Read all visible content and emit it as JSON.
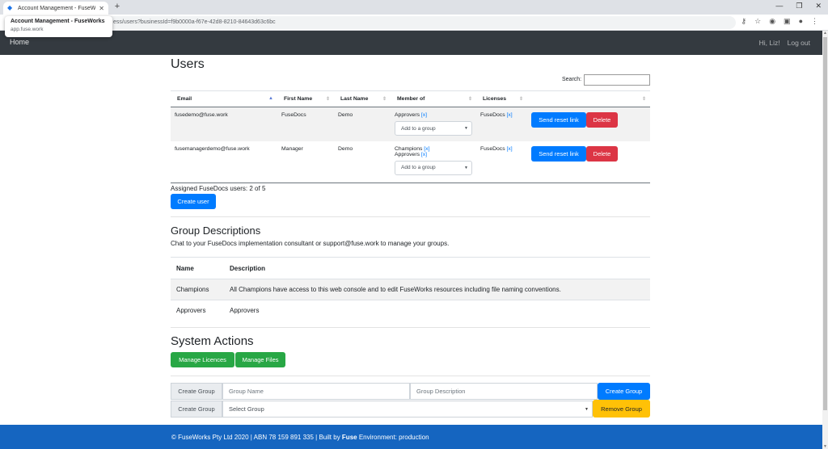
{
  "browser": {
    "tab_title": "Account Management - FuseWo",
    "url": "ess/users?businessId=f9b0000a-f67e-42d8-8210-84643d63c6bc",
    "tooltip_title": "Account Management - FuseWorks",
    "tooltip_url": "app.fuse.work"
  },
  "nav": {
    "home": "Home",
    "greeting": "Hi, Liz!",
    "logout": "Log out"
  },
  "users": {
    "title": "Users",
    "search_label": "Search:",
    "columns": [
      "Email",
      "First Name",
      "Last Name",
      "Member of",
      "Licenses",
      ""
    ],
    "rows": [
      {
        "email": "fusedemo@fuse.work",
        "first": "FuseDocs",
        "last": "Demo",
        "groups": [
          "Approvers"
        ],
        "licenses": [
          "FuseDocs"
        ],
        "select": "Add to a group",
        "reset": "Send reset link",
        "delete": "Delete"
      },
      {
        "email": "fusemanagerdemo@fuse.work",
        "first": "Manager",
        "last": "Demo",
        "groups": [
          "Champions",
          "Approvers"
        ],
        "licenses": [
          "FuseDocs"
        ],
        "select": "Add to a group",
        "reset": "Send reset link",
        "delete": "Delete"
      }
    ],
    "remove_marker": "[x]",
    "assigned": "Assigned FuseDocs users: 2 of 5",
    "create_user": "Create user"
  },
  "groups": {
    "title": "Group Descriptions",
    "subtitle": "Chat to your FuseDocs implementation consultant or support@fuse.work to manage your groups.",
    "col_name": "Name",
    "col_desc": "Description",
    "rows": [
      {
        "name": "Champions",
        "desc": "All Champions have access to this web console and to edit FuseWorks resources including file naming conventions."
      },
      {
        "name": "Approvers",
        "desc": "Approvers"
      }
    ]
  },
  "system": {
    "title": "System Actions",
    "manage_licences": "Manage Licences",
    "manage_files": "Manage Files",
    "create_group_addon": "Create Group",
    "group_name_placeholder": "Group Name",
    "group_desc_placeholder": "Group Description",
    "create_group_btn": "Create Group",
    "remove_group_addon": "Create Group",
    "select_group": "Select Group",
    "remove_group_btn": "Remove Group"
  },
  "footer": {
    "prefix": "© FuseWorks Pty Ltd 2020 | ABN 78 159 891 335 | Built by ",
    "brand": "Fuse",
    "suffix": " Environment: production"
  }
}
